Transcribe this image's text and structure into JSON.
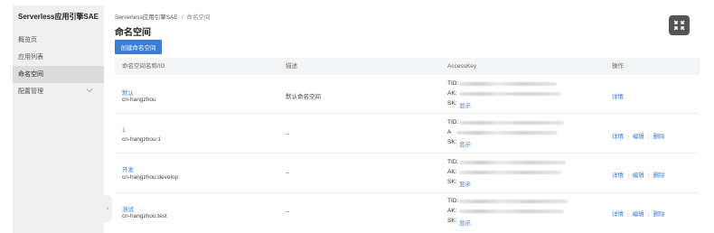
{
  "sidebar": {
    "title": "Serverless应用引擎SAE",
    "items": [
      {
        "label": "概览页",
        "active": false
      },
      {
        "label": "应用列表",
        "active": false
      },
      {
        "label": "命名空间",
        "active": true
      },
      {
        "label": "配置管理",
        "active": false,
        "expandable": true
      }
    ],
    "collapse_glyph": "‹"
  },
  "breadcrumb": {
    "root": "Serverless应用引擎SAE",
    "separator": "/",
    "current": "命名空间"
  },
  "page_title": "命名空间",
  "create_button_label": "创建命名空间",
  "table": {
    "headers": [
      "命名空间名称/ID",
      "描述",
      "AccessKey",
      "操作"
    ],
    "ak_labels": {
      "tid": "TID:",
      "ak": "AK:",
      "ak_short": "A",
      "sk": "SK:",
      "sk_show": "显示"
    },
    "rows": [
      {
        "name": "默认",
        "id": "cn-hangzhou",
        "description": "默认命名空间",
        "actions": [
          "详情"
        ]
      },
      {
        "name": "1",
        "id": "cn-hangzhou:1",
        "description": "--",
        "actions": [
          "详情",
          "编辑",
          "删除"
        ]
      },
      {
        "name": "开发",
        "id": "cn-hangzhou:develop",
        "description": "--",
        "actions": [
          "详情",
          "编辑",
          "删除"
        ]
      },
      {
        "name": "测试",
        "id": "cn-hangzhou:test",
        "description": "--",
        "actions": [
          "详情",
          "编辑",
          "删除"
        ]
      }
    ]
  },
  "colors": {
    "accent": "#3c7cd6",
    "sidebar_bg": "#f0f0f1",
    "fullscreen_bg": "#555555"
  },
  "icons": {
    "fullscreen": "fullscreen-icon",
    "chevron": "chevron-down-icon"
  }
}
